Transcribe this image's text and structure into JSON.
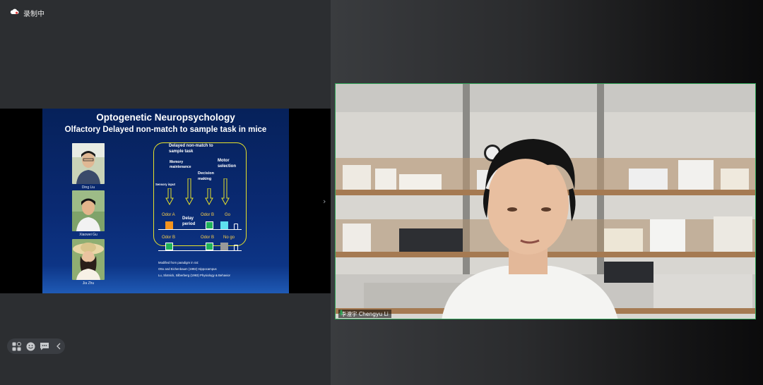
{
  "recording": {
    "label": "录制中",
    "icon": "cloud-recording-icon"
  },
  "slide": {
    "title": "Optogenetic Neuropsychology",
    "subtitle": "Olfactory Delayed non-match to sample task in mice",
    "people": [
      {
        "name": "Ding Liu"
      },
      {
        "name": "Xiaowei Gu"
      },
      {
        "name": "Jia Zhu"
      }
    ],
    "diagram": {
      "heading_line1": "Delayed non-match to",
      "heading_line2": "sample task",
      "memory_line1": "Memory",
      "memory_line2": "maintenance",
      "motor_line1": "Motor",
      "motor_line2": "selection",
      "sensory": "Sensory input",
      "decision_line1": "Decision",
      "decision_line2": "making",
      "delay_line1": "Delay",
      "delay_line2": "period",
      "row1": {
        "odor1": "Odor A",
        "odor2": "Odor B",
        "result": "Go"
      },
      "row2": {
        "odor1": "Odor B",
        "odor2": "Odor B",
        "result": "No go"
      },
      "colors": {
        "odor_a": "#f7941d",
        "odor_b": "#1fb35a",
        "go": "#5ee0f0",
        "nogo": "#9a9a9a",
        "box": "#e7e22b"
      }
    },
    "citation": {
      "line1": "Modified from paradigm in rat:",
      "line2": "Otto and Eichenbaum (1992) Hippocampus",
      "line3": "Lu, Slotnick, Silberberg (1993) Physiology & Behavior"
    }
  },
  "toolbar": {
    "items": [
      "grid-layout-icon",
      "emoji-icon",
      "chat-icon",
      "chevron-left-icon"
    ]
  },
  "video": {
    "participant_name": "李澄宇 Chengyu Li",
    "mic_icon": "microphone-icon",
    "active_speaker_color": "#2ea356"
  }
}
